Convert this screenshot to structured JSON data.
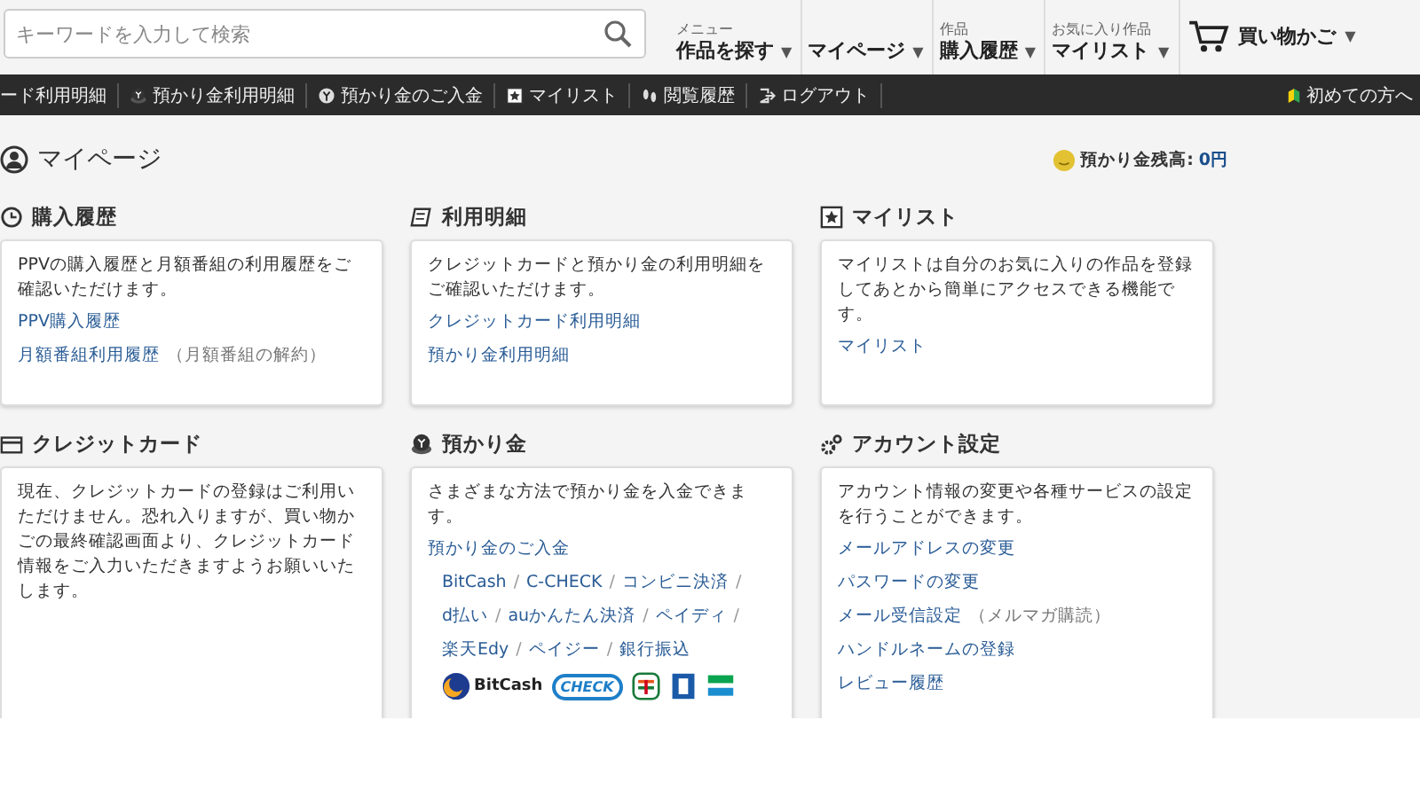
{
  "search": {
    "placeholder": "キーワードを入力して検索"
  },
  "nav": [
    {
      "kind": "menu",
      "small": "メニュー",
      "label": "作品を探す",
      "caret": "▼"
    },
    {
      "kind": "menu",
      "label": "マイページ",
      "caret": "▼"
    },
    {
      "kind": "menu",
      "small": "作品",
      "label": "購入履歴",
      "caret": "▼"
    },
    {
      "kind": "menu",
      "small": "お気に入り作品",
      "label": "マイリスト",
      "caret": "▼"
    },
    {
      "kind": "cart",
      "label": "買い物かご",
      "caret": "▼"
    }
  ],
  "subnav": [
    {
      "kind": "none",
      "label": "ード利用明細"
    },
    {
      "kind": "coins",
      "label": "預かり金利用明細"
    },
    {
      "kind": "coin",
      "label": "預かり金のご入金"
    },
    {
      "kind": "star",
      "label": "マイリスト"
    },
    {
      "kind": "feet",
      "label": "閲覧履歴"
    },
    {
      "kind": "logout",
      "label": "ログアウト"
    }
  ],
  "beginner": "初めての方へ",
  "page_title": "マイページ",
  "balance": {
    "label": "預かり金残高:",
    "value": "0円"
  },
  "sections": [
    {
      "kind": "clock",
      "title": "購入履歴",
      "description": "PPVの購入履歴と月額番組の利用履歴をご確認いただけます。",
      "links": [
        {
          "label": "PPV購入履歴"
        },
        {
          "label": "月額番組利用履歴",
          "note": "（月額番組の解約）"
        }
      ]
    },
    {
      "kind": "memo",
      "title": "利用明細",
      "description": "クレジットカードと預かり金の利用明細をご確認いただけます。",
      "links": [
        {
          "label": "クレジットカード利用明細"
        },
        {
          "label": "預かり金利用明細"
        }
      ]
    },
    {
      "kind": "star",
      "title": "マイリスト",
      "description": "マイリストは自分のお気に入りの作品を登録してあとから簡単にアクセスできる機能です。",
      "links": [
        {
          "label": "マイリスト"
        }
      ]
    },
    {
      "kind": "card",
      "title": "クレジットカード",
      "description": "現在、クレジットカードの登録はご利用いただけません。恐れ入りますが、買い物かごの最終確認画面より、クレジットカード情報をご入力いただきますようお願いいたします。"
    },
    {
      "kind": "coins",
      "title": "預かり金",
      "description": "さまざまな方法で預かり金を入金できます。",
      "links": [
        {
          "label": "預かり金のご入金"
        }
      ],
      "methods": [
        [
          {
            "label": "BitCash",
            "sep": "/"
          },
          {
            "label": "C-CHECK",
            "sep": "/"
          },
          {
            "label": "コンビニ決済",
            "sep": "/"
          }
        ],
        [
          {
            "label": "d払い",
            "sep": "/"
          },
          {
            "label": "auかんたん決済",
            "sep": "/"
          },
          {
            "label": "ペイディ",
            "sep": "/"
          }
        ],
        [
          {
            "label": "楽天Edy",
            "sep": "/"
          },
          {
            "label": "ペイジー",
            "sep": "/"
          },
          {
            "label": "銀行振込"
          }
        ]
      ],
      "logos": [
        {
          "kind": "bitcash",
          "label": "BitCash"
        },
        {
          "kind": "ccheck",
          "label": "CHECK"
        },
        {
          "kind": "seven"
        },
        {
          "kind": "blue"
        },
        {
          "kind": "family"
        }
      ]
    },
    {
      "kind": "gear",
      "title": "アカウント設定",
      "description": "アカウント情報の変更や各種サービスの設定を行うことができます。",
      "links": [
        {
          "label": "メールアドレスの変更"
        },
        {
          "label": "パスワードの変更"
        },
        {
          "label": "メール受信設定",
          "note": "（メルマガ購読）"
        },
        {
          "label": "ハンドルネームの登録"
        },
        {
          "label": "レビュー履歴"
        }
      ]
    }
  ]
}
